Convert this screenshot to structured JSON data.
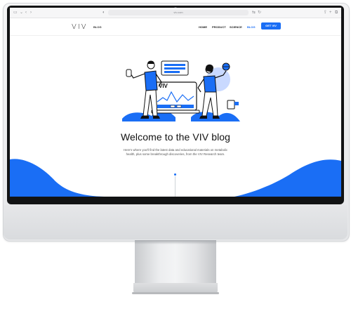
{
  "browser": {
    "url": "viv.com"
  },
  "site": {
    "logo": "VIV",
    "logo_sub": "BLOG",
    "nav": [
      "HOME",
      "PRODUCT",
      "SCIENCE",
      "BLOG"
    ],
    "cta": "GET VIV"
  },
  "hero": {
    "illustration_label": "VIV",
    "title": "Welcome to the VIV blog",
    "subtitle_line1": "Here's where you'll find the latest data and educational materials on metabolic",
    "subtitle_line2": "health, plus some breakthrough discoveries, from the VIV Research team."
  },
  "colors": {
    "accent": "#1a6ef5",
    "light_accent": "#c9d9ff",
    "wave": "#1a6ef5"
  }
}
